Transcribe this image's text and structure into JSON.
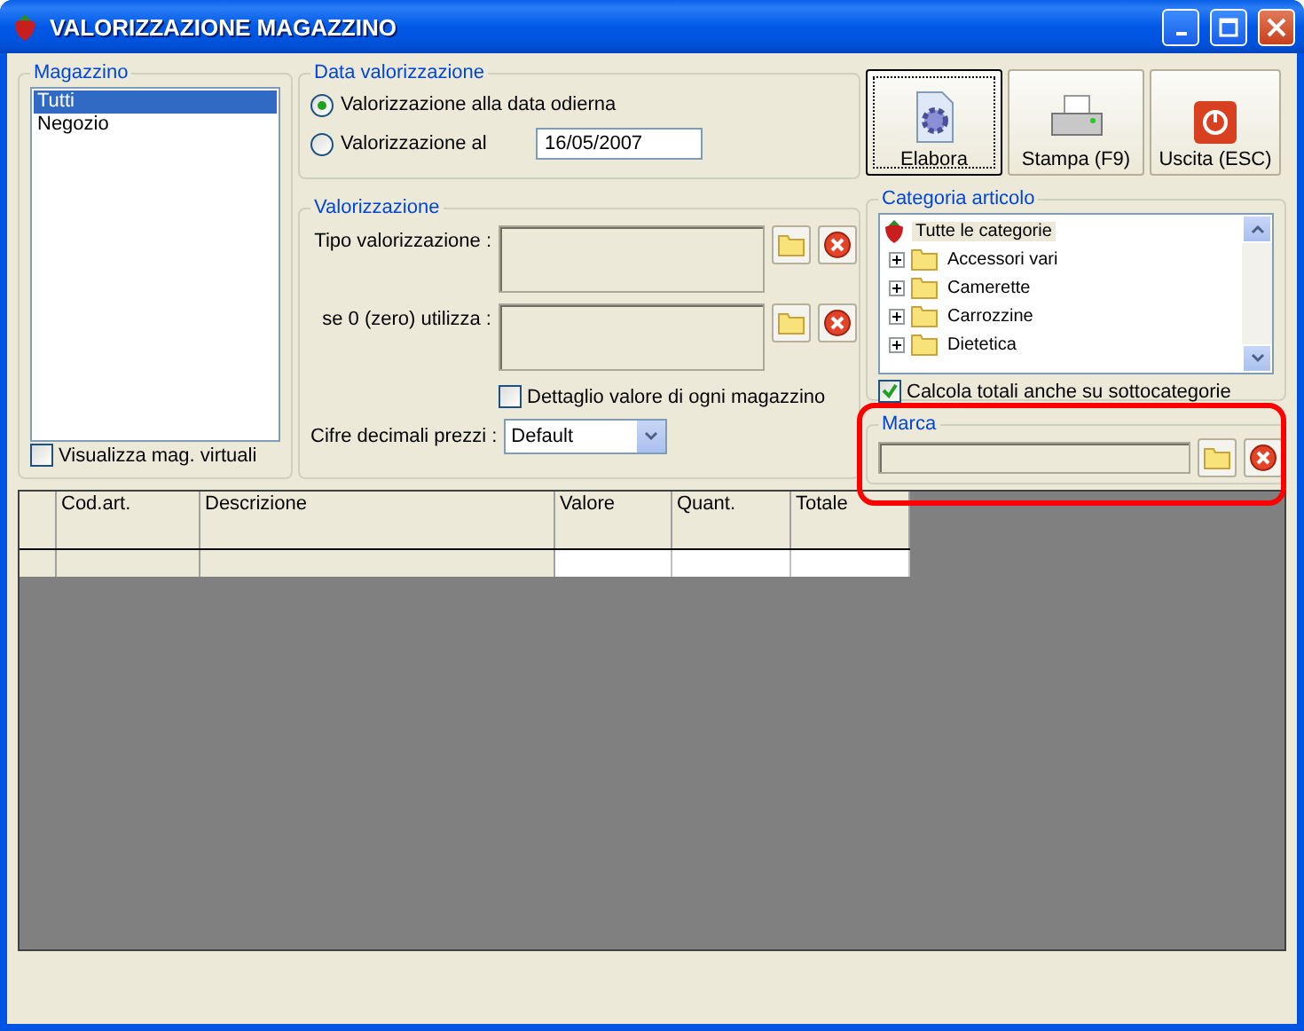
{
  "window": {
    "title": "VALORIZZAZIONE MAGAZZINO"
  },
  "magazzino": {
    "legend": "Magazzino",
    "items": [
      {
        "label": "Tutti",
        "selected": true
      },
      {
        "label": "Negozio",
        "selected": false
      }
    ],
    "virtual_checkbox": {
      "label": "Visualizza mag. virtuali",
      "checked": false
    }
  },
  "data_valorizzazione": {
    "legend": "Data valorizzazione",
    "options": [
      {
        "label": "Valorizzazione alla data odierna",
        "selected": true
      },
      {
        "label": "Valorizzazione al",
        "selected": false
      }
    ],
    "date": "16/05/2007"
  },
  "valorizzazione": {
    "legend": "Valorizzazione",
    "fields": [
      {
        "label": "Tipo valorizzazione :"
      },
      {
        "label": "se 0 (zero) utilizza :"
      }
    ],
    "detail_checkbox": {
      "label": "Dettaglio valore di ogni magazzino",
      "checked": false
    },
    "decimals": {
      "label": "Cifre decimali prezzi :",
      "value": "Default"
    }
  },
  "buttons": [
    {
      "label": "Elabora",
      "kind": "process",
      "focused": true
    },
    {
      "label": "Stampa (F9)",
      "kind": "print",
      "focused": false
    },
    {
      "label": "Uscita (ESC)",
      "kind": "exit",
      "focused": false
    }
  ],
  "categoria": {
    "legend": "Categoria articolo",
    "root": {
      "label": "Tutte le categorie",
      "selected": true
    },
    "children": [
      {
        "label": "Accessori vari",
        "expanded": false,
        "selected": false
      },
      {
        "label": "Camerette",
        "expanded": false,
        "selected": false
      },
      {
        "label": "Carrozzine",
        "expanded": false,
        "selected": false
      },
      {
        "label": "Dietetica",
        "expanded": false,
        "selected": false
      }
    ],
    "subcategories_checkbox": {
      "label": "Calcola totali anche su sottocategorie",
      "checked": true
    }
  },
  "marca": {
    "legend": "Marca"
  },
  "table": {
    "columns": [
      "Cod.art.",
      "Descrizione",
      "Valore",
      "Quant.",
      "Totale"
    ]
  }
}
